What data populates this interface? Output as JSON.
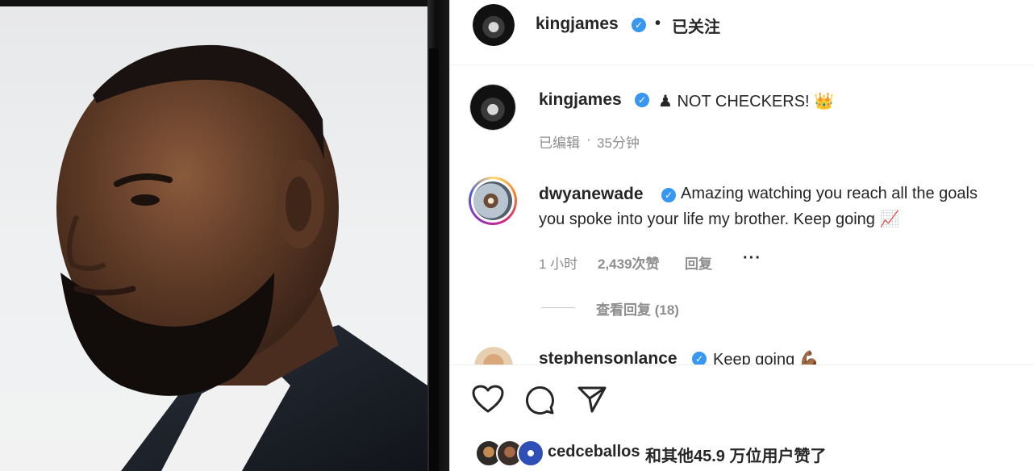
{
  "header": {
    "username": "kingjames",
    "verified_mark": "✓",
    "separator": "•",
    "follow_status": "已关注"
  },
  "caption": {
    "username": "kingjames",
    "text": "♟ NOT CHECKERS! 👑",
    "edited": "已编辑",
    "dot": "·",
    "time": "35分钟"
  },
  "comments": [
    {
      "username": "dwyanewade",
      "text_line1": "Amazing watching you reach all the goals",
      "text_line2": "you spoke into your life my brother. Keep going 📈",
      "time": "1 小时",
      "likes": "2,439次赞",
      "reply": "回复",
      "more": "···",
      "view_replies": "查看回复 (18)"
    },
    {
      "username": "stephensonlance",
      "text": "Keep going 💪🏾"
    }
  ],
  "actions": {
    "like_icon": "heart-icon",
    "comment_icon": "comment-icon",
    "share_icon": "paper-plane-icon"
  },
  "likes_summary": {
    "first_user": "cedceballos",
    "rest": "和其他45.9 万位用户赞了"
  },
  "colors": {
    "verified": "#3897f0",
    "secondary_text": "#8e8e8e",
    "primary_text": "#262626",
    "story_ring": "#d6249f"
  }
}
